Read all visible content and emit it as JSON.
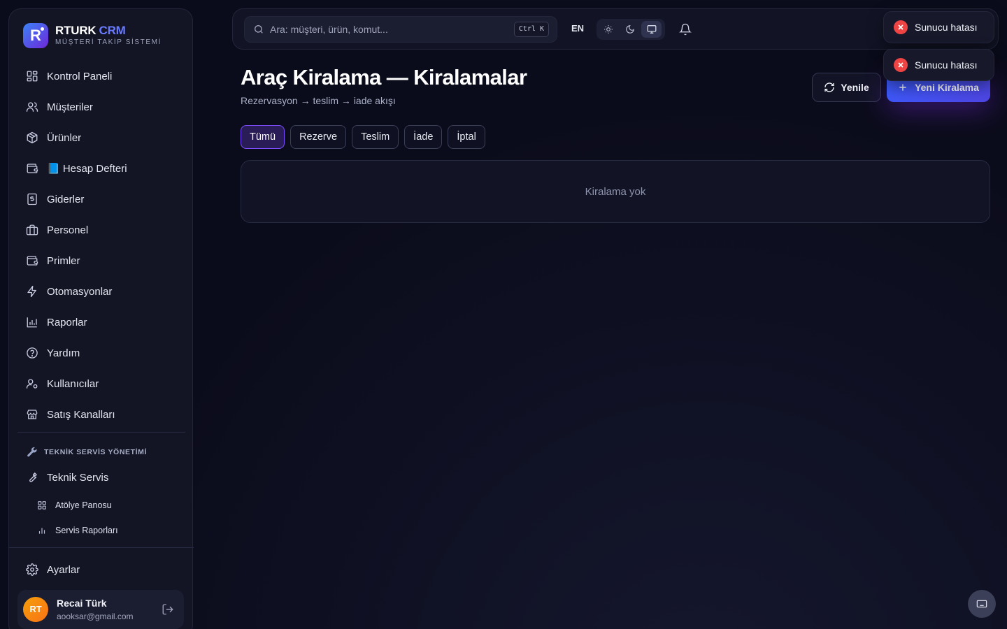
{
  "brand": {
    "logo_letter": "R",
    "name": "RTURK",
    "name_accent": "CRM",
    "subtitle": "MÜŞTERİ TAKİP SİSTEMİ"
  },
  "sidebar": {
    "items": [
      {
        "label": "Kontrol Paneli",
        "icon": "dashboard-icon"
      },
      {
        "label": "Müşteriler",
        "icon": "users-icon"
      },
      {
        "label": "Ürünler",
        "icon": "package-icon"
      },
      {
        "label": "📘 Hesap Defteri",
        "icon": "wallet-icon"
      },
      {
        "label": "Giderler",
        "icon": "receipt-icon"
      },
      {
        "label": "Personel",
        "icon": "briefcase-icon"
      },
      {
        "label": "Primler",
        "icon": "wallet-icon"
      },
      {
        "label": "Otomasyonlar",
        "icon": "bolt-icon"
      },
      {
        "label": "Raporlar",
        "icon": "bar-chart-icon"
      },
      {
        "label": "Yardım",
        "icon": "help-icon"
      },
      {
        "label": "Kullanıcılar",
        "icon": "user-cog-icon"
      },
      {
        "label": "Satış Kanalları",
        "icon": "store-icon"
      }
    ],
    "section_title": "TEKNİK SERVİS YÖNETİMİ",
    "section_main": "Teknik Servis",
    "section_subitems": [
      "Atölye Panosu",
      "Servis Raporları"
    ],
    "settings_label": "Ayarlar",
    "user": {
      "initials": "RT",
      "name": "Recai Türk",
      "email": "aooksar@gmail.com"
    }
  },
  "topbar": {
    "search_placeholder": "Ara: müşteri, ürün, komut...",
    "shortcut": "Ctrl K",
    "language": "EN",
    "theme_active": "system"
  },
  "main": {
    "title": "Araç Kiralama — Kiralamalar",
    "subtitle": "Rezervasyon → teslim → iade akışı",
    "refresh_label": "Yenile",
    "new_label": "Yeni Kiralama",
    "tabs": [
      {
        "label": "Tümü",
        "active": true
      },
      {
        "label": "Rezerve",
        "active": false
      },
      {
        "label": "Teslim",
        "active": false
      },
      {
        "label": "İade",
        "active": false
      },
      {
        "label": "İptal",
        "active": false
      }
    ],
    "empty_text": "Kiralama yok"
  },
  "toasts": [
    {
      "text": "Sunucu hatası"
    },
    {
      "text": "Sunucu hatası"
    }
  ],
  "colors": {
    "accent": "#4f46e5",
    "error": "#ef4444",
    "active_tab": "#7c4dff"
  }
}
